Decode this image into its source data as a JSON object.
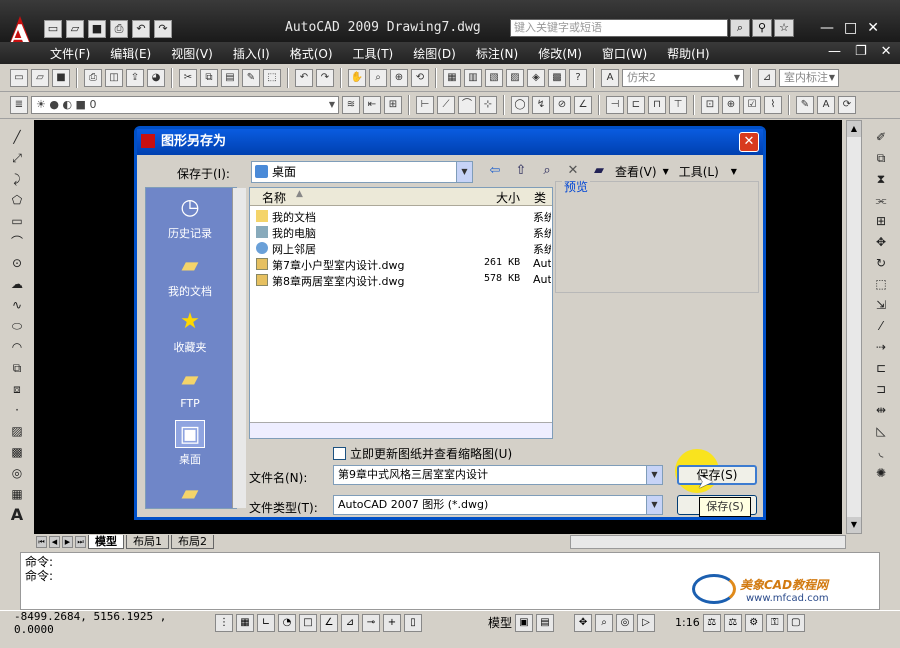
{
  "app": {
    "title": "AutoCAD 2009 Drawing7.dwg",
    "search_placeholder": "键入关键字或短语",
    "menus": [
      "文件(F)",
      "编辑(E)",
      "视图(V)",
      "插入(I)",
      "格式(O)",
      "工具(T)",
      "绘图(D)",
      "标注(N)",
      "修改(M)",
      "窗口(W)",
      "帮助(H)"
    ],
    "textstyle": "仿宋2",
    "dimstyle": "室内标注",
    "layer_value": "0"
  },
  "layout_tabs": [
    "模型",
    "布局1",
    "布局2"
  ],
  "command_lines": [
    "命令:",
    "命令:"
  ],
  "brand": {
    "name": "美象CAD教程网",
    "url": "www.mfcad.com"
  },
  "status": {
    "coords": "-8499.2684,  5156.1925 , 0.0000",
    "model_label": "模型",
    "scale": "1:16"
  },
  "dialog": {
    "title": "图形另存为",
    "save_in_label": "保存于(I):",
    "save_in_value": "桌面",
    "views_label": "查看(V)",
    "tools_label": "工具(L)",
    "places": [
      "历史记录",
      "我的文档",
      "收藏夹",
      "FTP",
      "桌面"
    ],
    "columns": {
      "name": "名称",
      "size": "大小",
      "type": "类"
    },
    "files": [
      {
        "name": "我的文档",
        "size": "",
        "type": "系统"
      },
      {
        "name": "我的电脑",
        "size": "",
        "type": "系统"
      },
      {
        "name": "网上邻居",
        "size": "",
        "type": "系统"
      },
      {
        "name": "第7章小户型室内设计.dwg",
        "size": "261 KB",
        "type": "Aut"
      },
      {
        "name": "第8章两居室室内设计.dwg",
        "size": "578 KB",
        "type": "Aut"
      }
    ],
    "preview_label": "预览",
    "update_checkbox": "立即更新图纸并查看缩略图(U)",
    "filename_label": "文件名(N):",
    "filename_value": "第9章中式风格三居室室内设计",
    "filetype_label": "文件类型(T):",
    "filetype_value": "AutoCAD 2007 图形 (*.dwg)",
    "save_button": "保存(S)",
    "tooltip": "保存(S)"
  }
}
